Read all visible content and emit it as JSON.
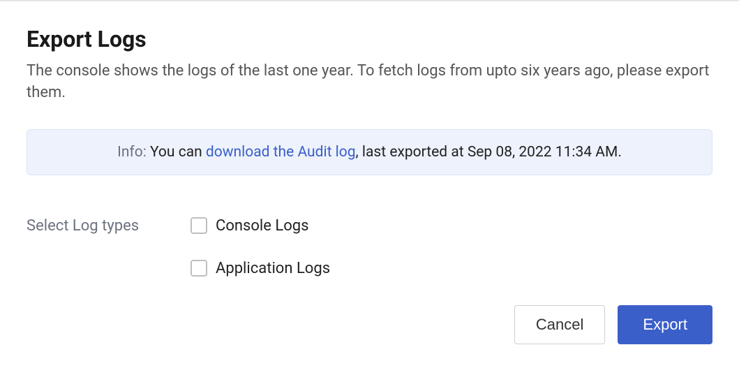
{
  "header": {
    "title": "Export Logs",
    "description": "The console shows the logs of the last one year. To fetch logs from upto six years ago, please export them."
  },
  "info": {
    "label": "Info:",
    "prefix_text": " You can ",
    "link_text": "download the Audit log",
    "suffix_text": ", last exported at Sep 08, 2022 11:34 AM."
  },
  "form": {
    "select_label": "Select Log types",
    "options": [
      {
        "label": "Console Logs",
        "checked": false
      },
      {
        "label": "Application Logs",
        "checked": false
      }
    ]
  },
  "buttons": {
    "cancel": "Cancel",
    "export": "Export"
  }
}
